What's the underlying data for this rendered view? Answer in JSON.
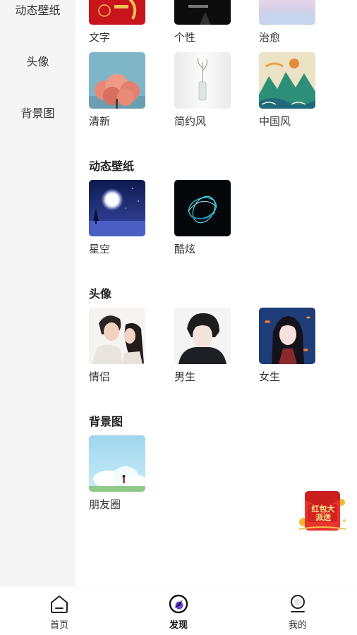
{
  "sidebar": {
    "items": [
      {
        "label": "动态壁纸"
      },
      {
        "label": "头像"
      },
      {
        "label": "背景图"
      }
    ]
  },
  "top_row": [
    {
      "label": "文字",
      "image": "red-greeting-card"
    },
    {
      "label": "个性",
      "image": "dark-portrait"
    },
    {
      "label": "治愈",
      "image": "pastel-sky"
    }
  ],
  "second_row": [
    {
      "label": "清新",
      "image": "pink-blossom-tree"
    },
    {
      "label": "简约风",
      "image": "white-vase-plant"
    },
    {
      "label": "中国风",
      "image": "chinese-landscape-painting"
    }
  ],
  "sections": {
    "live": {
      "title": "动态壁纸",
      "items": [
        {
          "label": "星空",
          "image": "moonlit-night"
        },
        {
          "label": "酷炫",
          "image": "blue-light-swirl"
        }
      ]
    },
    "avatar": {
      "title": "头像",
      "items": [
        {
          "label": "情侣",
          "image": "anime-couple"
        },
        {
          "label": "男生",
          "image": "anime-boy"
        },
        {
          "label": "女生",
          "image": "anime-girl"
        }
      ]
    },
    "background": {
      "title": "背景图",
      "items": [
        {
          "label": "朋友圈",
          "image": "sky-clouds-figure"
        }
      ]
    }
  },
  "redpacket": {
    "text": "红包大派送",
    "image": "red-packet-promo"
  },
  "bottom_nav": {
    "items": [
      {
        "label": "首页",
        "icon": "home-icon"
      },
      {
        "label": "发现",
        "icon": "compass-icon",
        "active": true
      },
      {
        "label": "我的",
        "icon": "profile-icon"
      }
    ]
  },
  "colors": {
    "sidebar_bg": "#f5f5f5",
    "accent": "#6b3fe0",
    "text": "#333333"
  }
}
